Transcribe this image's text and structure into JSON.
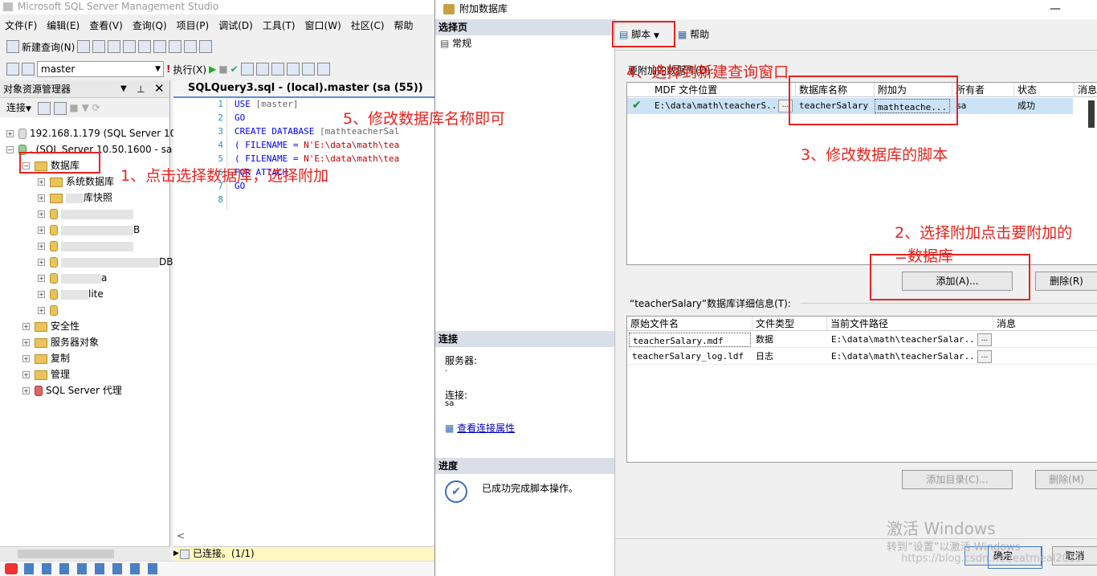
{
  "ssms": {
    "title": "Microsoft SQL Server Management Studio",
    "menu": [
      "文件(F)",
      "编辑(E)",
      "查看(V)",
      "查询(Q)",
      "项目(P)",
      "调试(D)",
      "工具(T)",
      "窗口(W)",
      "社区(C)",
      "帮助"
    ],
    "toolbar1": {
      "new_query": "新建查询(N)"
    },
    "toolbar2": {
      "database": "master",
      "execute": "执行(X)"
    },
    "object_explorer": {
      "title": "对象资源管理器",
      "connect": "连接",
      "nodes": {
        "server1": "192.168.1.179 (SQL Server 10",
        "server2": ". (SQL Server 10.50.1600 - sa",
        "databases": "数据库",
        "system_db": "系统数据库",
        "snapshot": "库快照",
        "partial1": "B",
        "partial2": "DB",
        "partial3": "a",
        "partial4": "lite",
        "security": "安全性",
        "server_objects": "服务器对象",
        "replication": "复制",
        "management": "管理",
        "agent": "SQL Server 代理"
      }
    },
    "editor": {
      "tab": "SQLQuery3.sql - (local).master (sa (55))",
      "lines": [
        {
          "n": "1",
          "kw": "USE ",
          "rest": "[master]",
          "str": ""
        },
        {
          "n": "2",
          "kw": "GO",
          "rest": "",
          "str": ""
        },
        {
          "n": "3",
          "kw": "CREATE DATABASE ",
          "rest": "[mathteacherSal",
          "str": ""
        },
        {
          "n": "4",
          "kw": "( FILENAME = ",
          "rest": "",
          "str": "N'E:\\data\\math\\tea"
        },
        {
          "n": "5",
          "kw": "( FILENAME = ",
          "rest": "",
          "str": "N'E:\\data\\math\\tea"
        },
        {
          "n": "6",
          "kw": "FOR ATTACH",
          "rest": "",
          "str": ""
        },
        {
          "n": "7",
          "kw": "GO",
          "rest": "",
          "str": ""
        },
        {
          "n": "8",
          "kw": "",
          "rest": "",
          "str": ""
        }
      ]
    },
    "status": "已连接。(1/1)"
  },
  "dialog": {
    "title": "附加数据库",
    "left": {
      "select_page": "选择页",
      "general": "常规",
      "connection": "连接",
      "server_label": "服务器:",
      "server_value": ".",
      "conn_label": "连接:",
      "conn_value": "sa",
      "view_props": "查看连接属性",
      "progress": "进度",
      "progress_msg": "已成功完成脚本操作。"
    },
    "toolbar": {
      "script": "脚本",
      "help": "帮助"
    },
    "attach_label": "要附加的数据库(D):",
    "attach_grid": {
      "headers": [
        "MDF 文件位置",
        "数据库名称",
        "附加为",
        "所有者",
        "状态",
        "消息"
      ],
      "row": {
        "mdf": "E:\\data\\math\\teacherS...",
        "dbname": "teacherSalary",
        "attach_as": "mathteache...",
        "owner": "sa",
        "status": "成功"
      }
    },
    "add_button": "添加(A)...",
    "remove_button": "删除(R)",
    "details_label": "“teacherSalary”数据库详细信息(T):",
    "details_grid": {
      "headers": [
        "原始文件名",
        "文件类型",
        "当前文件路径",
        "消息"
      ],
      "rows": [
        {
          "name": "teacherSalary.mdf",
          "type": "数据",
          "path": "E:\\data\\math\\teacherSalar..."
        },
        {
          "name": "teacherSalary_log.ldf",
          "type": "日志",
          "path": "E:\\data\\math\\teacherSalar..."
        }
      ]
    },
    "add_catalog": "添加目录(C)...",
    "remove2": "删除(M)",
    "ok": "确定",
    "cancel": "取消"
  },
  "annotations": {
    "a1": "1、点击选择数据库，选择附加",
    "a2_l1": "2、选择附加点击要附加的",
    "a2_l2": "=数据库",
    "a3": "3、修改数据库的脚本",
    "a4": "4、选择到新建查询窗口",
    "a5": "5、修改数据库名称即可"
  },
  "watermark": {
    "l1": "激活 Windows",
    "l2": "转到“设置”以激活 Windows",
    "l3": "https://blog.csdn.net/eatmeal2019"
  }
}
